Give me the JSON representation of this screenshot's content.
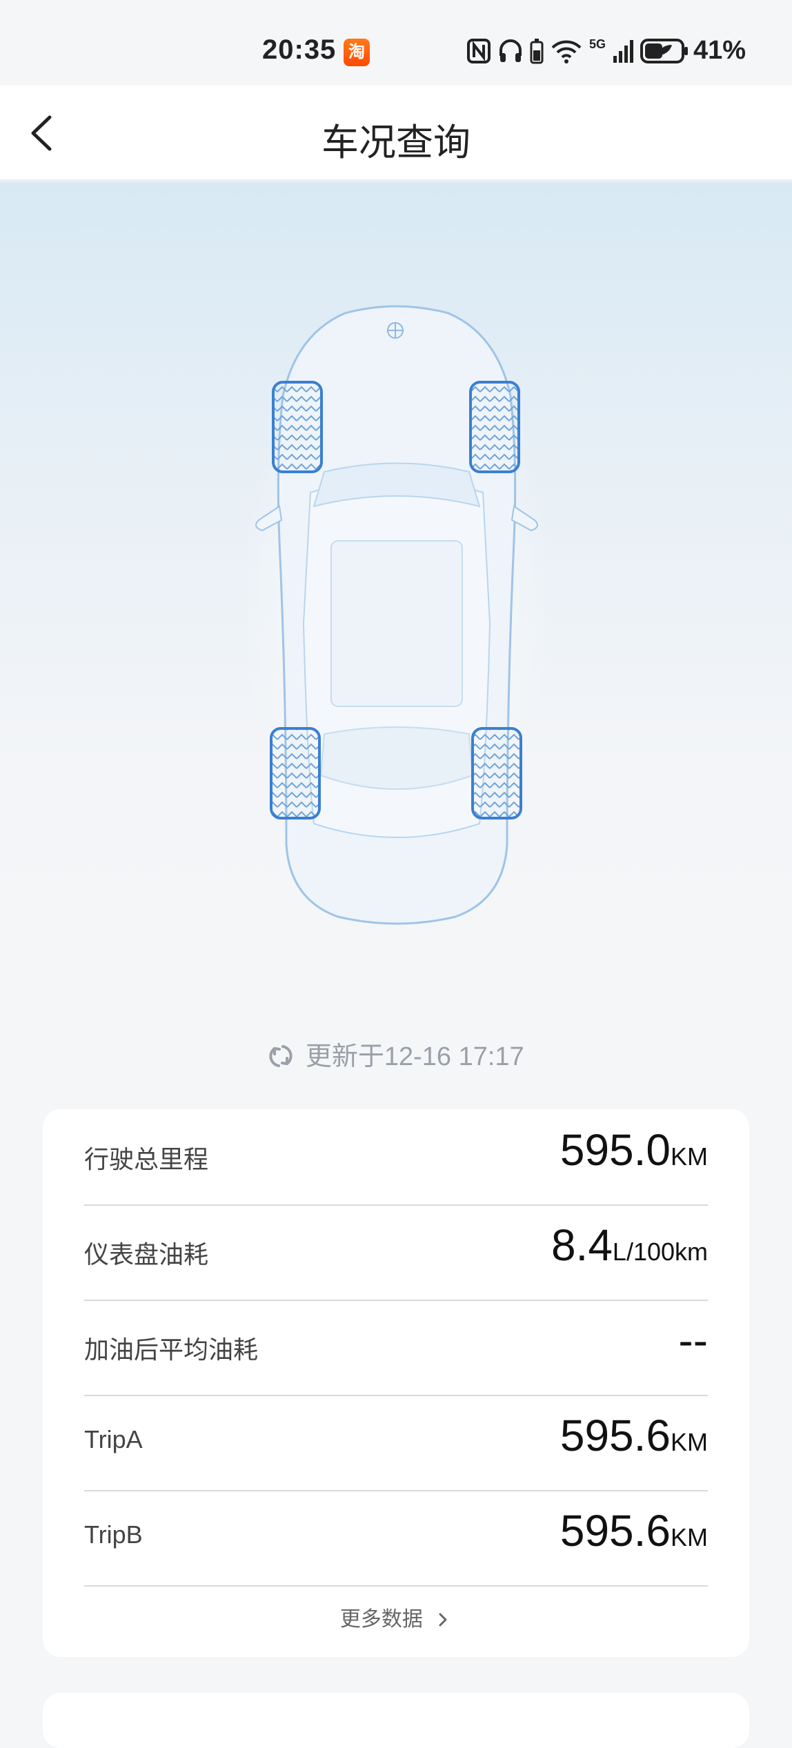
{
  "status_bar": {
    "time": "20:35",
    "taobao_badge": "淘",
    "battery_percent": "41%",
    "network": "5G"
  },
  "header": {
    "title": "车况查询",
    "back_icon": "chevron-left-icon"
  },
  "update": {
    "text": "更新于12-16 17:17",
    "icon": "refresh-icon"
  },
  "metrics": [
    {
      "label": "行驶总里程",
      "value": "595.0",
      "unit": "KM"
    },
    {
      "label": "仪表盘油耗",
      "value": "8.4",
      "unit": "L/100km"
    },
    {
      "label": "加油后平均油耗",
      "value": "--",
      "unit": ""
    },
    {
      "label": "TripA",
      "value": "595.6",
      "unit": "KM"
    },
    {
      "label": "TripB",
      "value": "595.6",
      "unit": "KM"
    }
  ],
  "more": {
    "label": "更多数据",
    "icon": "chevron-right-icon"
  },
  "colors": {
    "accent": "#3b7fd0",
    "car_outline": "#9ec4e8",
    "bg": "#f5f6f8"
  }
}
